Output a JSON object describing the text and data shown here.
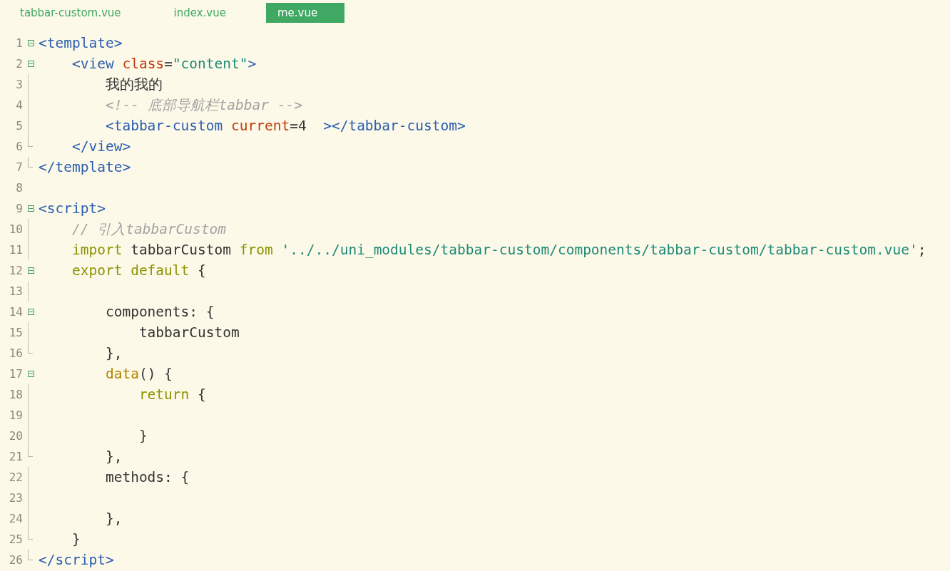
{
  "tabs": [
    {
      "label": "tabbar-custom.vue",
      "selected": false
    },
    {
      "label": "index.vue",
      "selected": false
    },
    {
      "label": "me.vue",
      "selected": true
    }
  ],
  "lines": [
    {
      "number": "1",
      "kind": "start",
      "tokens": [
        {
          "kind": "tag",
          "text": "<template>"
        }
      ]
    },
    {
      "number": "2",
      "kind": "start",
      "tokens": [
        {
          "kind": "tag",
          "text": "    <view"
        },
        {
          "kind": "attr",
          "text": " class"
        },
        {
          "kind": "plain",
          "text": "="
        },
        {
          "kind": "string",
          "text": "\"content\""
        },
        {
          "kind": "tag",
          "text": ">"
        }
      ]
    },
    {
      "number": "3",
      "kind": "inner",
      "tokens": [
        {
          "kind": "plain",
          "text": "        我的我的"
        }
      ]
    },
    {
      "number": "4",
      "kind": "inner",
      "tokens": [
        {
          "kind": "comment",
          "text": "        <!-- 底部导航栏tabbar -->"
        }
      ]
    },
    {
      "number": "5",
      "kind": "inner",
      "tokens": [
        {
          "kind": "tag",
          "text": "        <tabbar-custom"
        },
        {
          "kind": "attr",
          "text": " current"
        },
        {
          "kind": "plain",
          "text": "=4  "
        },
        {
          "kind": "tag",
          "text": "></tabbar-custom>"
        }
      ]
    },
    {
      "number": "6",
      "kind": "end",
      "tokens": [
        {
          "kind": "tag",
          "text": "    </view>"
        }
      ]
    },
    {
      "number": "7",
      "kind": "end",
      "tokens": [
        {
          "kind": "tag",
          "text": "</template>"
        }
      ]
    },
    {
      "number": "8",
      "kind": "none"
    },
    {
      "number": "9",
      "kind": "start",
      "tokens": [
        {
          "kind": "tag",
          "text": "<script>"
        }
      ]
    },
    {
      "number": "10",
      "kind": "inner",
      "tokens": [
        {
          "kind": "comment",
          "text": "    // 引入tabbarCustom"
        }
      ]
    },
    {
      "number": "11",
      "kind": "inner",
      "tokens": [
        {
          "kind": "keyword",
          "text": "    import"
        },
        {
          "kind": "plain",
          "text": " tabbarCustom "
        },
        {
          "kind": "keyword",
          "text": "from"
        },
        {
          "kind": "string",
          "text": " '../../uni_modules/tabbar-custom/components/tabbar-custom/tabbar-custom.vue'"
        },
        {
          "kind": "plain",
          "text": ";"
        }
      ]
    },
    {
      "number": "12",
      "kind": "start",
      "tokens": [
        {
          "kind": "keyword",
          "text": "    export default"
        },
        {
          "kind": "plain",
          "text": " {"
        }
      ]
    },
    {
      "number": "13",
      "kind": "inner"
    },
    {
      "number": "14",
      "kind": "start",
      "tokens": [
        {
          "kind": "plain",
          "text": "        components: {"
        }
      ]
    },
    {
      "number": "15",
      "kind": "inner",
      "tokens": [
        {
          "kind": "plain",
          "text": "            tabbarCustom"
        }
      ]
    },
    {
      "number": "16",
      "kind": "end",
      "tokens": [
        {
          "kind": "plain",
          "text": "        },"
        }
      ]
    },
    {
      "number": "17",
      "kind": "start",
      "tokens": [
        {
          "kind": "func",
          "text": "        data"
        },
        {
          "kind": "plain",
          "text": "() {"
        }
      ]
    },
    {
      "number": "18",
      "kind": "inner",
      "tokens": [
        {
          "kind": "keyword",
          "text": "            return"
        },
        {
          "kind": "plain",
          "text": " {"
        }
      ]
    },
    {
      "number": "19",
      "kind": "inner"
    },
    {
      "number": "20",
      "kind": "inner",
      "tokens": [
        {
          "kind": "plain",
          "text": "            }"
        }
      ]
    },
    {
      "number": "21",
      "kind": "end",
      "tokens": [
        {
          "kind": "plain",
          "text": "        },"
        }
      ]
    },
    {
      "number": "22",
      "kind": "inner",
      "tokens": [
        {
          "kind": "plain",
          "text": "        methods: {"
        }
      ]
    },
    {
      "number": "23",
      "kind": "inner"
    },
    {
      "number": "24",
      "kind": "inner",
      "tokens": [
        {
          "kind": "plain",
          "text": "        },"
        }
      ]
    },
    {
      "number": "25",
      "kind": "end",
      "tokens": [
        {
          "kind": "plain",
          "text": "    }"
        }
      ]
    },
    {
      "number": "26",
      "kind": "end",
      "tokens": [
        {
          "kind": "tag",
          "text": "</script>"
        }
      ]
    }
  ]
}
